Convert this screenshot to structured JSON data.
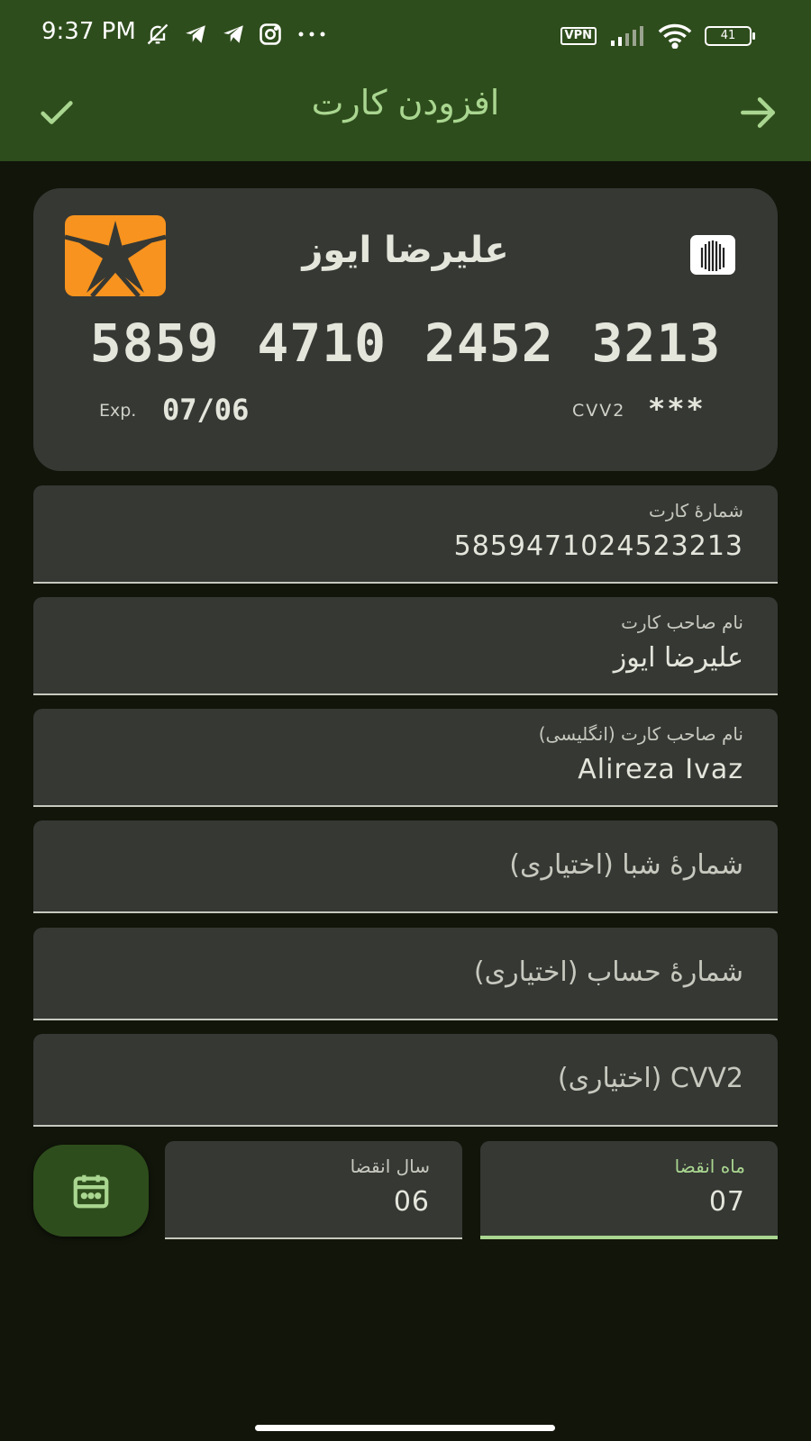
{
  "status_bar": {
    "time": "9:37 PM",
    "vpn_label": "VPN",
    "battery": "41",
    "icons": [
      "bell-off-icon",
      "telegram-icon",
      "telegram-icon",
      "instagram-icon",
      "more-dots-icon",
      "signal-icon",
      "wifi-icon",
      "battery-icon"
    ]
  },
  "app_bar": {
    "title": "افزودن کارت",
    "confirm_icon": "check-icon",
    "back_icon": "arrow-right-icon"
  },
  "card_preview": {
    "holder_name": "علیرضا ایوز",
    "number_display": "5859 4710 2452 3213",
    "exp_label": "Exp.",
    "exp_value": "07/06",
    "cvv_label": "CVV2",
    "cvv_value": "***",
    "bank_logo_icon": "bank-logo-icon",
    "chip_icon": "card-chip-icon"
  },
  "form": {
    "card_number": {
      "label": "شمارهٔ کارت",
      "value": "5859471024523213"
    },
    "holder_name": {
      "label": "نام صاحب کارت",
      "value": "علیرضا ایوز"
    },
    "holder_name_en": {
      "label": "نام صاحب کارت (انگلیسی)",
      "value": "Alireza Ivaz"
    },
    "sheba": {
      "placeholder": "شمارهٔ شبا (اختیاری)"
    },
    "account_number": {
      "placeholder": "شمارهٔ حساب (اختیاری)"
    },
    "cvv2": {
      "placeholder": "CVV2 (اختیاری)"
    },
    "exp_year": {
      "label": "سال انقضا",
      "value": "06"
    },
    "exp_month": {
      "label": "ماه انقضا",
      "value": "07"
    },
    "calendar_icon": "calendar-icon"
  },
  "colors": {
    "accent": "#a9d690",
    "appbar_bg": "#2e4d1c",
    "background": "#11150a",
    "surface": "#363834",
    "bank_orange": "#f7931e"
  }
}
